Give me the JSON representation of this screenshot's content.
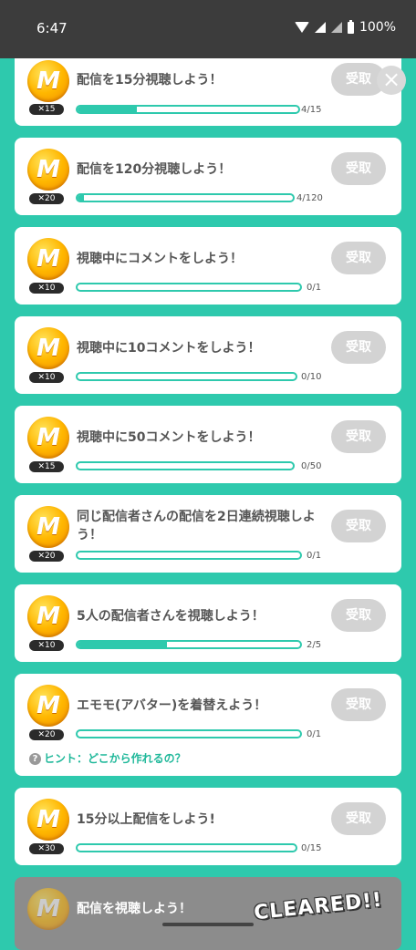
{
  "status_bar": {
    "time": "6:47",
    "battery": "100%"
  },
  "claim_label": "受取",
  "missions": [
    {
      "title": "配信を15分視聴しよう！",
      "multiplier": "✕15",
      "progress": 0.27,
      "count": "4/15"
    },
    {
      "title": "配信を120分視聴しよう！",
      "multiplier": "✕20",
      "progress": 0.03,
      "count": "4/120"
    },
    {
      "title": "視聴中にコメントをしよう！",
      "multiplier": "✕10",
      "progress": 0,
      "count": "0/1"
    },
    {
      "title": "視聴中に10コメントをしよう！",
      "multiplier": "✕10",
      "progress": 0,
      "count": "0/10"
    },
    {
      "title": "視聴中に50コメントをしよう！",
      "multiplier": "✕15",
      "progress": 0,
      "count": "0/50"
    },
    {
      "title": "同じ配信者さんの配信を2日連続視聴しよう！",
      "multiplier": "✕20",
      "progress": 0,
      "count": "0/1"
    },
    {
      "title": "5人の配信者さんを視聴しよう！",
      "multiplier": "✕10",
      "progress": 0.4,
      "count": "2/5"
    },
    {
      "title": "エモモ(アバター)を着替えよう！",
      "multiplier": "✕20",
      "progress": 0,
      "count": "0/1",
      "hint": "ヒント：どこから作れるの？"
    },
    {
      "title": "15分以上配信をしよう!",
      "multiplier": "✕30",
      "progress": 0,
      "count": "0/15"
    },
    {
      "title": "配信を視聴しよう！",
      "cleared_label": "CLEARED!!"
    }
  ],
  "coin_letter": "M",
  "icons": {
    "close": "close-icon",
    "coin": "coin-icon",
    "hint": "question-icon"
  }
}
